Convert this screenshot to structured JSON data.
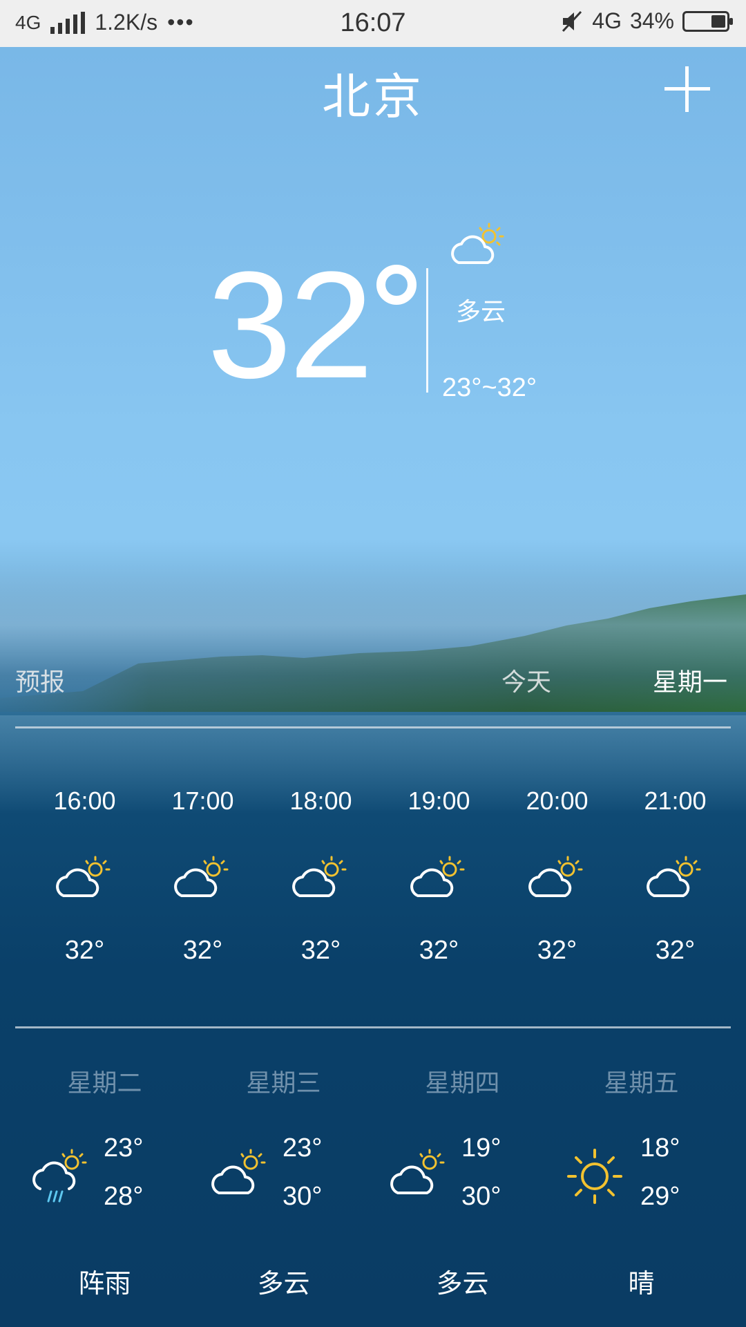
{
  "status_bar": {
    "network": "4G",
    "speed": "1.2K/s",
    "dots": "•••",
    "time": "16:07",
    "network_right": "4G",
    "battery": "34%"
  },
  "header": {
    "city": "北京",
    "add_icon": "plus-icon"
  },
  "current": {
    "temp": "32",
    "condition": "多云",
    "range": "23°~32°",
    "icon": "partly-cloudy-icon"
  },
  "forecast_header": {
    "label": "预报",
    "today": "今天",
    "day": "星期一"
  },
  "hourly": [
    {
      "time": "16:00",
      "temp": "32°",
      "icon": "partly-cloudy-icon"
    },
    {
      "time": "17:00",
      "temp": "32°",
      "icon": "partly-cloudy-icon"
    },
    {
      "time": "18:00",
      "temp": "32°",
      "icon": "partly-cloudy-icon"
    },
    {
      "time": "19:00",
      "temp": "32°",
      "icon": "partly-cloudy-icon"
    },
    {
      "time": "20:00",
      "temp": "32°",
      "icon": "partly-cloudy-icon"
    },
    {
      "time": "21:00",
      "temp": "32°",
      "icon": "partly-cloudy-icon"
    }
  ],
  "daily": [
    {
      "name": "星期二",
      "low": "23°",
      "high": "28°",
      "condition": "阵雨",
      "icon": "shower-icon"
    },
    {
      "name": "星期三",
      "low": "23°",
      "high": "30°",
      "condition": "多云",
      "icon": "partly-cloudy-icon"
    },
    {
      "name": "星期四",
      "low": "19°",
      "high": "30°",
      "condition": "多云",
      "icon": "partly-cloudy-icon"
    },
    {
      "name": "星期五",
      "low": "18°",
      "high": "29°",
      "condition": "晴",
      "icon": "sunny-icon"
    }
  ],
  "colors": {
    "sun": "#f2c230",
    "rain": "#5ec8f0",
    "text": "#ffffff"
  }
}
